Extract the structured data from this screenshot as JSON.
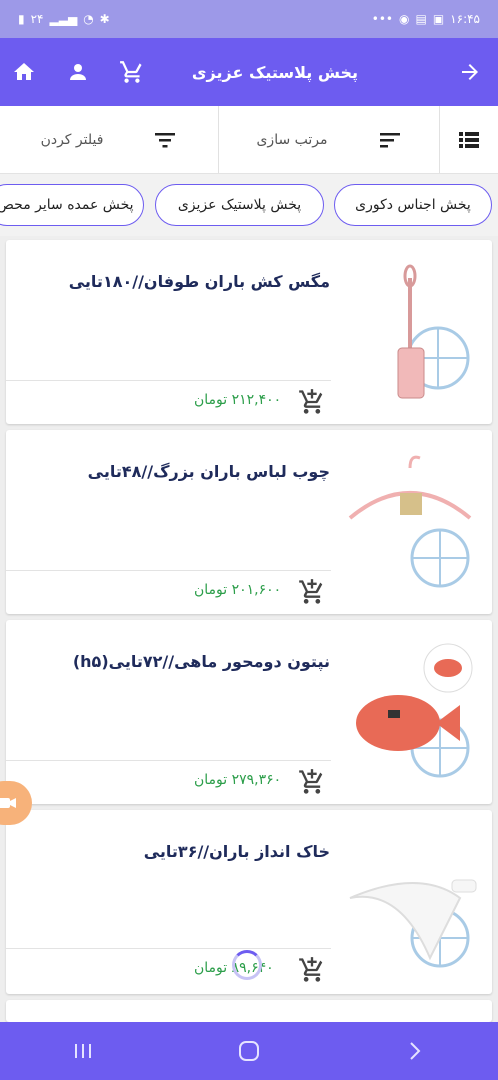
{
  "status": {
    "time": "۱۶:۴۵",
    "left_text": "۲۴"
  },
  "appbar": {
    "title": "پخش پلاستیک عزیزی",
    "icons": [
      "back-arrow-icon",
      "cart-icon",
      "user-icon",
      "home-icon"
    ]
  },
  "toolbar": {
    "filter_label": "فیلتر کردن",
    "sort_label": "مرتب سازی",
    "view_icon": "list-view-icon"
  },
  "chips": [
    {
      "label": "پخش اجناس دکوری"
    },
    {
      "label": "پخش پلاستیک عزیزی"
    },
    {
      "label": "پخش عمده سایر محص"
    }
  ],
  "products": [
    {
      "name": "مگس کش باران طوفان//۱۸۰تایی",
      "price": "۲۱۲,۴۰۰ تومان"
    },
    {
      "name": "چوب لباس باران بزرگ//۴۸تایی",
      "price": "۲۰۱,۶۰۰ تومان"
    },
    {
      "name": "نپتون دومحور ماهی//۷۲تایی(h۵)",
      "price": "۲۷۹,۳۶۰ تومان"
    },
    {
      "name": "خاک انداز باران//۳۶تایی",
      "price": "۸۹,۶۴۰ تومان"
    }
  ],
  "colors": {
    "primary": "#6d5cf0",
    "price": "#2c9e4a",
    "title": "#1f2b5b"
  }
}
